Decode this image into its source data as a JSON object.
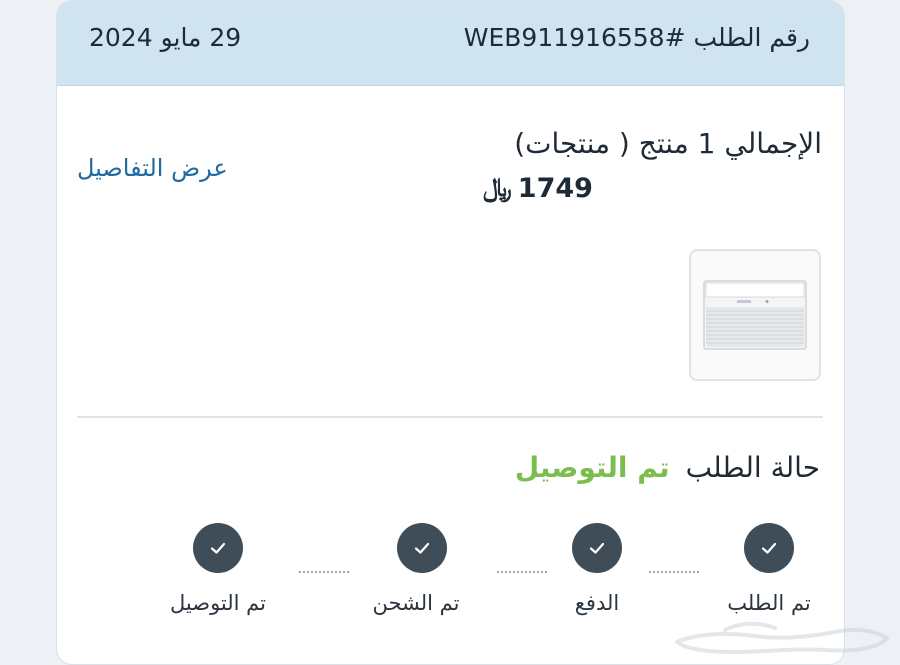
{
  "order": {
    "number": "رقم الطلب #WEB911916558",
    "date": "29 مايو 2024"
  },
  "summary": {
    "title": "الإجمالي 1 منتج ( منتجات)",
    "price": "1749",
    "currency_symbol": "﷼",
    "details_link": "عرض التفاصيل"
  },
  "product": {
    "image_icon": "air-conditioner-icon"
  },
  "status": {
    "label": "حالة الطلب",
    "value": "تم التوصيل",
    "value_color": "#7bbd4e"
  },
  "steps": [
    {
      "label": "تم الطلب",
      "icon": "check-icon"
    },
    {
      "label": "الدفع",
      "icon": "check-icon"
    },
    {
      "label": "تم الشحن",
      "icon": "check-icon"
    },
    {
      "label": "تم التوصيل",
      "icon": "check-icon"
    }
  ],
  "watermark": {
    "text": "حراج"
  }
}
